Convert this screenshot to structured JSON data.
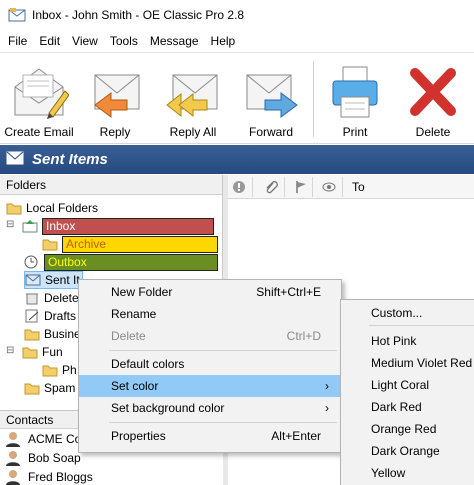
{
  "window": {
    "title": "Inbox - John Smith - OE Classic Pro 2.8"
  },
  "menu": [
    "File",
    "Edit",
    "View",
    "Tools",
    "Message",
    "Help"
  ],
  "toolbar": {
    "create_email": "Create Email",
    "reply": "Reply",
    "reply_all": "Reply All",
    "forward": "Forward",
    "print": "Print",
    "delete": "Delete"
  },
  "banner": {
    "title": "Sent Items"
  },
  "folders": {
    "header": "Folders",
    "items": [
      {
        "label": "Local Folders"
      },
      {
        "label": "Inbox",
        "bg": "#c0504d",
        "fg": "#ffffff"
      },
      {
        "label": "Archive",
        "bg": "#ffd700",
        "fg": "#c06000"
      },
      {
        "label": "Outbox",
        "bg": "#6b8e23",
        "fg": "#ffff00"
      },
      {
        "label": "Sent It"
      },
      {
        "label": "Delete"
      },
      {
        "label": "Drafts"
      },
      {
        "label": "Busine"
      },
      {
        "label": "Fun"
      },
      {
        "label": "Ph"
      },
      {
        "label": "Spam"
      }
    ]
  },
  "contacts": {
    "header": "Contacts",
    "items": [
      "ACME Co",
      "Bob Soap",
      "Fred Bloggs"
    ]
  },
  "message_list": {
    "to_header": "To"
  },
  "context_menu": {
    "items": [
      {
        "label": "New Folder",
        "shortcut": "Shift+Ctrl+E"
      },
      {
        "label": "Rename",
        "shortcut": ""
      },
      {
        "label": "Delete",
        "shortcut": "Ctrl+D"
      },
      {
        "label": "Default colors",
        "shortcut": ""
      },
      {
        "label": "Set color",
        "shortcut": ""
      },
      {
        "label": "Set background color",
        "shortcut": ""
      },
      {
        "label": "Properties",
        "shortcut": "Alt+Enter"
      }
    ]
  },
  "color_submenu": {
    "items": [
      "Custom...",
      "Hot Pink",
      "Medium Violet Red",
      "Light Coral",
      "Dark Red",
      "Orange Red",
      "Dark Orange",
      "Yellow"
    ]
  }
}
